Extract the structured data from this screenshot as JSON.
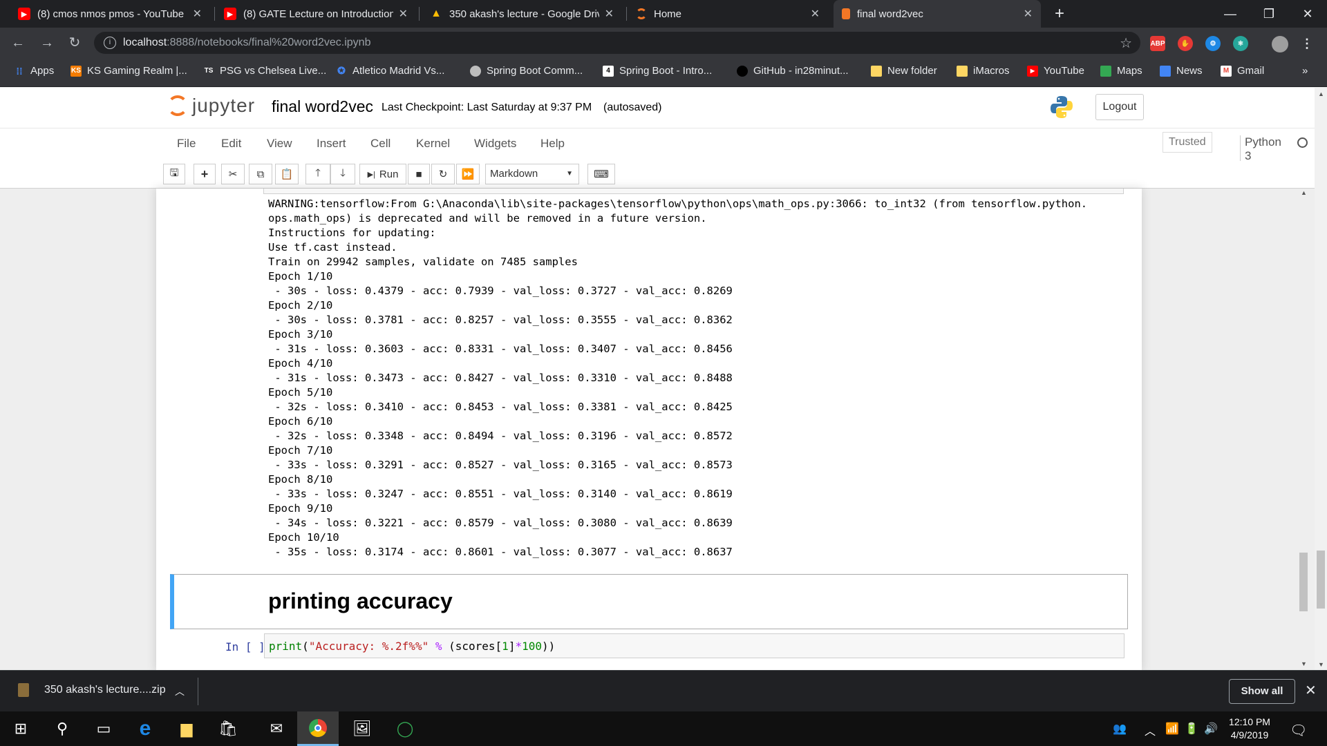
{
  "browser": {
    "tabs": [
      {
        "title": "(8) cmos nmos pmos - YouTube",
        "icon": "youtube-icon",
        "active": false
      },
      {
        "title": "(8) GATE Lecture on Introduction",
        "icon": "youtube-icon",
        "active": false
      },
      {
        "title": "350 akash's lecture - Google Driv",
        "icon": "google-drive-icon",
        "active": false
      },
      {
        "title": "Home",
        "icon": "jupyter-icon",
        "active": false
      },
      {
        "title": "final word2vec",
        "icon": "notebook-icon",
        "active": true
      }
    ],
    "url_host": "localhost",
    "url_path": ":8888/notebooks/final%20word2vec.ipynb",
    "extensions": [
      "ABP"
    ],
    "bookmarks": [
      {
        "label": "Apps",
        "icon": "apps-grid-icon"
      },
      {
        "label": "KS Gaming Realm |...",
        "icon": "ks-gaming-icon"
      },
      {
        "label": "PSG vs Chelsea Live...",
        "icon": "ts-icon"
      },
      {
        "label": "Atletico Madrid Vs...",
        "icon": "soccer-icon"
      },
      {
        "label": "Spring Boot Comm...",
        "icon": "spring-icon"
      },
      {
        "label": "Spring Boot - Intro...",
        "icon": "udemy-icon"
      },
      {
        "label": "GitHub - in28minut...",
        "icon": "github-icon"
      },
      {
        "label": "New folder",
        "icon": "folder-icon"
      },
      {
        "label": "iMacros",
        "icon": "folder-icon"
      },
      {
        "label": "YouTube",
        "icon": "youtube-icon"
      },
      {
        "label": "Maps",
        "icon": "maps-icon"
      },
      {
        "label": "News",
        "icon": "news-icon"
      },
      {
        "label": "Gmail",
        "icon": "gmail-icon"
      }
    ],
    "more_bookmarks": "»"
  },
  "jupyter": {
    "logo_text": "jupyter",
    "notebook_name": "final word2vec",
    "checkpoint": "Last Checkpoint: Last Saturday at 9:37 PM",
    "autosave": "(autosaved)",
    "logout": "Logout",
    "menu": [
      "File",
      "Edit",
      "View",
      "Insert",
      "Cell",
      "Kernel",
      "Widgets",
      "Help"
    ],
    "trusted": "Trusted",
    "kernel": "Python 3",
    "run_label": "Run",
    "cell_type": "Markdown"
  },
  "output_lines": [
    "WARNING:tensorflow:From G:\\Anaconda\\lib\\site-packages\\tensorflow\\python\\ops\\math_ops.py:3066: to_int32 (from tensorflow.python.",
    "ops.math_ops) is deprecated and will be removed in a future version.",
    "Instructions for updating:",
    "Use tf.cast instead.",
    "Train on 29942 samples, validate on 7485 samples",
    "Epoch 1/10",
    " - 30s - loss: 0.4379 - acc: 0.7939 - val_loss: 0.3727 - val_acc: 0.8269",
    "Epoch 2/10",
    " - 30s - loss: 0.3781 - acc: 0.8257 - val_loss: 0.3555 - val_acc: 0.8362",
    "Epoch 3/10",
    " - 31s - loss: 0.3603 - acc: 0.8331 - val_loss: 0.3407 - val_acc: 0.8456",
    "Epoch 4/10",
    " - 31s - loss: 0.3473 - acc: 0.8427 - val_loss: 0.3310 - val_acc: 0.8488",
    "Epoch 5/10",
    " - 32s - loss: 0.3410 - acc: 0.8453 - val_loss: 0.3381 - val_acc: 0.8425",
    "Epoch 6/10",
    " - 32s - loss: 0.3348 - acc: 0.8494 - val_loss: 0.3196 - val_acc: 0.8572",
    "Epoch 7/10",
    " - 33s - loss: 0.3291 - acc: 0.8527 - val_loss: 0.3165 - val_acc: 0.8573",
    "Epoch 8/10",
    " - 33s - loss: 0.3247 - acc: 0.8551 - val_loss: 0.3140 - val_acc: 0.8619",
    "Epoch 9/10",
    " - 34s - loss: 0.3221 - acc: 0.8579 - val_loss: 0.3080 - val_acc: 0.8639",
    "Epoch 10/10",
    " - 35s - loss: 0.3174 - acc: 0.8601 - val_loss: 0.3077 - val_acc: 0.8637"
  ],
  "markdown_heading": "printing accuracy",
  "code_cell": {
    "prompt": "In [ ]:",
    "fn": "print",
    "open": "(",
    "string": "\"Accuracy: %.2f%%\"",
    "op": " % ",
    "rest_a": "(scores[",
    "num": "1",
    "rest_b": "]",
    "times": "*",
    "num2": "100",
    "close": "))"
  },
  "downloads": {
    "file": "350 akash's lecture....zip",
    "show_all": "Show all"
  },
  "taskbar": {
    "time": "12:10 PM",
    "date": "4/9/2019"
  },
  "colors": {
    "cell_selected_border": "#42a5f5",
    "jupyter_orange": "#f37726"
  }
}
